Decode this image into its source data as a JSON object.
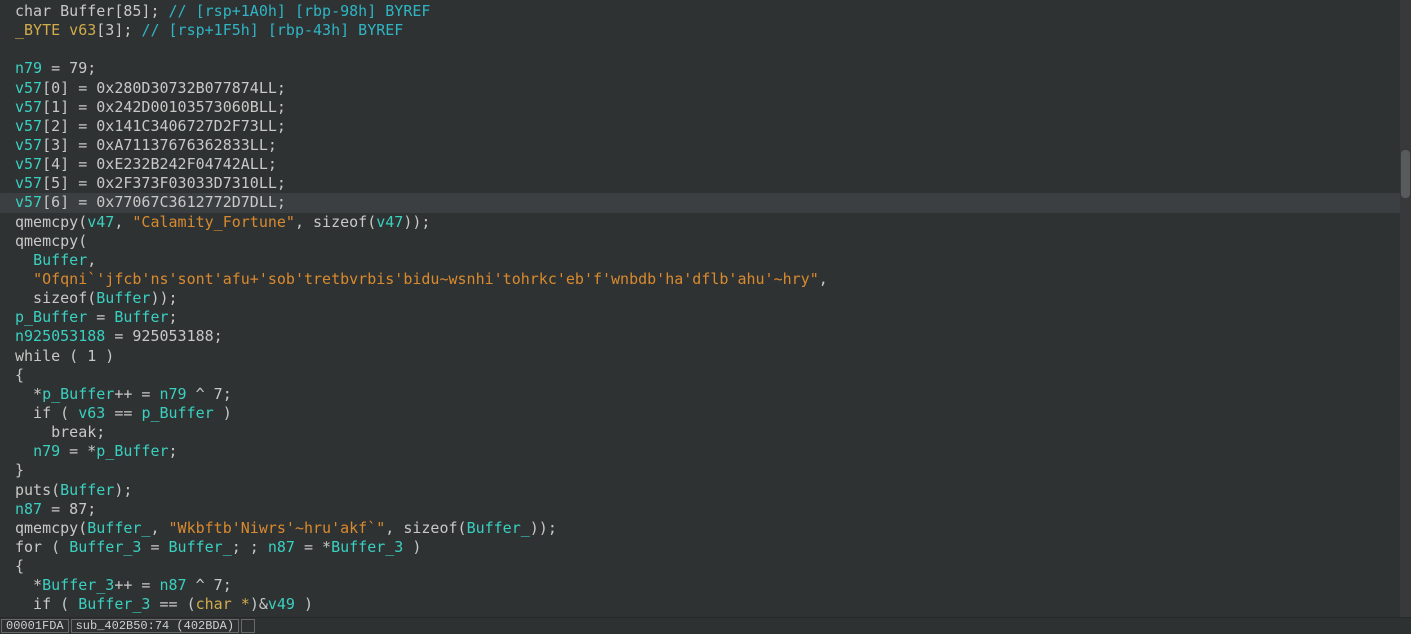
{
  "app": "ida-pro-hexrays-pseudocode",
  "colors": {
    "background": "#2f3233",
    "line_highlight": "#3b3f41",
    "scrollbar_track": "#37393b",
    "scrollbar_thumb": "#585b5c",
    "syntax": {
      "p": "#c7c9c7",
      "v": "#3ad0c0",
      "s": "#d98a2e",
      "c": "#2fb5c4",
      "t": "#d2ac4a"
    }
  },
  "status_bar": {
    "address": "00001FDA",
    "location": "sub_402B50:74 (402BDA)"
  },
  "code": {
    "highlight_line_index": 10,
    "lines": [
      {
        "tokens": [
          [
            "p",
            "char Buffer[85]; "
          ],
          [
            "c",
            "// [rsp+1A0h] [rbp-98h] BYREF"
          ]
        ]
      },
      {
        "tokens": [
          [
            "t",
            "_BYTE v63"
          ],
          [
            "p",
            "[3]; "
          ],
          [
            "c",
            "// [rsp+1F5h] [rbp-43h] BYREF"
          ]
        ]
      },
      {
        "tokens": []
      },
      {
        "tokens": [
          [
            "v",
            "n79"
          ],
          [
            "p",
            " = 79;"
          ]
        ]
      },
      {
        "tokens": [
          [
            "v",
            "v57"
          ],
          [
            "p",
            "[0] = 0x280D30732B077874LL;"
          ]
        ]
      },
      {
        "tokens": [
          [
            "v",
            "v57"
          ],
          [
            "p",
            "[1] = 0x242D00103573060BLL;"
          ]
        ]
      },
      {
        "tokens": [
          [
            "v",
            "v57"
          ],
          [
            "p",
            "[2] = 0x141C3406727D2F73LL;"
          ]
        ]
      },
      {
        "tokens": [
          [
            "v",
            "v57"
          ],
          [
            "p",
            "[3] = 0xA71137676362833LL;"
          ]
        ]
      },
      {
        "tokens": [
          [
            "v",
            "v57"
          ],
          [
            "p",
            "[4] = 0xE232B242F04742ALL;"
          ]
        ]
      },
      {
        "tokens": [
          [
            "v",
            "v57"
          ],
          [
            "p",
            "[5] = 0x2F373F03033D7310LL;"
          ]
        ]
      },
      {
        "hl": true,
        "tokens": [
          [
            "v",
            "v57"
          ],
          [
            "p",
            "[6] = 0x77067C3612772D7DLL;"
          ]
        ]
      },
      {
        "tokens": [
          [
            "p",
            "qmemcpy("
          ],
          [
            "v",
            "v47"
          ],
          [
            "p",
            ", "
          ],
          [
            "s",
            "\"Calamity_Fortune\""
          ],
          [
            "p",
            ", sizeof("
          ],
          [
            "v",
            "v47"
          ],
          [
            "p",
            "));"
          ]
        ]
      },
      {
        "tokens": [
          [
            "p",
            "qmemcpy("
          ]
        ]
      },
      {
        "tokens": [
          [
            "p",
            "  "
          ],
          [
            "v",
            "Buffer"
          ],
          [
            "p",
            ","
          ]
        ]
      },
      {
        "tokens": [
          [
            "p",
            "  "
          ],
          [
            "s",
            "\"Ofqni`'jfcb'ns'sont'afu+'sob'tretbvrbis'bidu~wsnhi'tohrkc'eb'f'wnbdb'ha'dflb'ahu'~hry\""
          ],
          [
            "p",
            ","
          ]
        ]
      },
      {
        "tokens": [
          [
            "p",
            "  sizeof("
          ],
          [
            "v",
            "Buffer"
          ],
          [
            "p",
            "));"
          ]
        ]
      },
      {
        "tokens": [
          [
            "v",
            "p_Buffer"
          ],
          [
            "p",
            " = "
          ],
          [
            "v",
            "Buffer"
          ],
          [
            "p",
            ";"
          ]
        ]
      },
      {
        "tokens": [
          [
            "v",
            "n925053188"
          ],
          [
            "p",
            " = 925053188;"
          ]
        ]
      },
      {
        "tokens": [
          [
            "p",
            "while ( 1 )"
          ]
        ]
      },
      {
        "tokens": [
          [
            "p",
            "{"
          ]
        ]
      },
      {
        "tokens": [
          [
            "p",
            "  *"
          ],
          [
            "v",
            "p_Buffer"
          ],
          [
            "p",
            "++ = "
          ],
          [
            "v",
            "n79"
          ],
          [
            "p",
            " ^ 7;"
          ]
        ]
      },
      {
        "tokens": [
          [
            "p",
            "  if ( "
          ],
          [
            "v",
            "v63"
          ],
          [
            "p",
            " == "
          ],
          [
            "v",
            "p_Buffer"
          ],
          [
            "p",
            " )"
          ]
        ]
      },
      {
        "tokens": [
          [
            "p",
            "    break;"
          ]
        ]
      },
      {
        "tokens": [
          [
            "p",
            "  "
          ],
          [
            "v",
            "n79"
          ],
          [
            "p",
            " = *"
          ],
          [
            "v",
            "p_Buffer"
          ],
          [
            "p",
            ";"
          ]
        ]
      },
      {
        "tokens": [
          [
            "p",
            "}"
          ]
        ]
      },
      {
        "tokens": [
          [
            "p",
            "puts("
          ],
          [
            "v",
            "Buffer"
          ],
          [
            "p",
            ");"
          ]
        ]
      },
      {
        "tokens": [
          [
            "v",
            "n87"
          ],
          [
            "p",
            " = 87;"
          ]
        ]
      },
      {
        "tokens": [
          [
            "p",
            "qmemcpy("
          ],
          [
            "v",
            "Buffer_"
          ],
          [
            "p",
            ", "
          ],
          [
            "s",
            "\"Wkbftb'Niwrs'~hru'akf`\""
          ],
          [
            "p",
            ", sizeof("
          ],
          [
            "v",
            "Buffer_"
          ],
          [
            "p",
            "));"
          ]
        ]
      },
      {
        "tokens": [
          [
            "p",
            "for ( "
          ],
          [
            "v",
            "Buffer_3"
          ],
          [
            "p",
            " = "
          ],
          [
            "v",
            "Buffer_"
          ],
          [
            "p",
            "; ; "
          ],
          [
            "v",
            "n87"
          ],
          [
            "p",
            " = *"
          ],
          [
            "v",
            "Buffer_3"
          ],
          [
            "p",
            " )"
          ]
        ]
      },
      {
        "tokens": [
          [
            "p",
            "{"
          ]
        ]
      },
      {
        "tokens": [
          [
            "p",
            "  *"
          ],
          [
            "v",
            "Buffer_3"
          ],
          [
            "p",
            "++ = "
          ],
          [
            "v",
            "n87"
          ],
          [
            "p",
            " ^ 7;"
          ]
        ]
      },
      {
        "tokens": [
          [
            "p",
            "  if ( "
          ],
          [
            "v",
            "Buffer_3"
          ],
          [
            "p",
            " == ("
          ],
          [
            "t",
            "char *"
          ],
          [
            "p",
            ")&"
          ],
          [
            "v",
            "v49"
          ],
          [
            "p",
            " )"
          ]
        ]
      }
    ]
  }
}
